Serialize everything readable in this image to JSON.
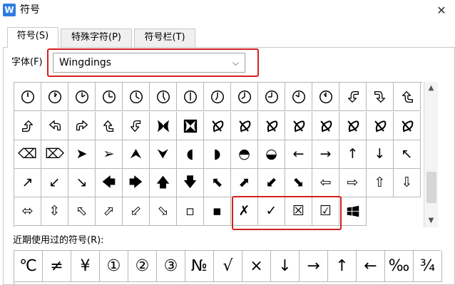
{
  "window": {
    "title": "符号",
    "app_icon_letter": "W",
    "close_glyph": "✕"
  },
  "tabs": [
    {
      "label": "符号(S)",
      "active": true
    },
    {
      "label": "特殊字符(P)",
      "active": false
    },
    {
      "label": "符号栏(T)",
      "active": false
    }
  ],
  "font": {
    "label": "字体(F)",
    "value": "Wingdings",
    "chevron": "⌵"
  },
  "grid": {
    "rows": [
      [
        {
          "icon": "clock-12-icon"
        },
        {
          "icon": "clock-1-icon"
        },
        {
          "icon": "clock-2-icon"
        },
        {
          "icon": "clock-3-icon"
        },
        {
          "icon": "clock-4-icon"
        },
        {
          "icon": "clock-5-icon"
        },
        {
          "icon": "clock-6-icon"
        },
        {
          "icon": "clock-7-icon"
        },
        {
          "icon": "clock-8-icon"
        },
        {
          "icon": "clock-9-icon"
        },
        {
          "icon": "clock-10-icon"
        },
        {
          "icon": "clock-11-icon"
        },
        {
          "icon": "curved-arrow-down-left-icon"
        },
        {
          "icon": "curved-arrow-down-right-icon"
        },
        {
          "icon": "curved-arrow-up-left-icon"
        }
      ],
      [
        {
          "icon": "curved-arrow-up-right-icon"
        },
        {
          "icon": "curved-arrow-left-icon"
        },
        {
          "icon": "curved-arrow-right-icon"
        },
        {
          "icon": "curved-arrow-up-icon"
        },
        {
          "icon": "curved-arrow-down-icon"
        },
        {
          "icon": "ornament-leaf-icon"
        },
        {
          "icon": "ornament-square-icon"
        },
        {
          "icon": "ampersand-leaf-icon"
        },
        {
          "icon": "ampersand-leaf-icon"
        },
        {
          "icon": "ampersand-leaf-icon"
        },
        {
          "icon": "ampersand-leaf-icon"
        },
        {
          "icon": "ampersand-leaf-icon"
        },
        {
          "icon": "ampersand-leaf-icon"
        },
        {
          "icon": "ampersand-leaf-icon"
        },
        {
          "icon": "ampersand-leaf-icon"
        }
      ],
      [
        {
          "glyph": "⌫"
        },
        {
          "glyph": "⌦"
        },
        {
          "glyph": "➤"
        },
        {
          "glyph": "➢"
        },
        {
          "glyph": "⮝"
        },
        {
          "glyph": "⮟"
        },
        {
          "glyph": "◖"
        },
        {
          "glyph": "◗"
        },
        {
          "glyph": "◓"
        },
        {
          "glyph": "◒"
        },
        {
          "glyph": "←"
        },
        {
          "glyph": "→"
        },
        {
          "glyph": "↑"
        },
        {
          "glyph": "↓"
        },
        {
          "glyph": "↖"
        }
      ],
      [
        {
          "glyph": "↗"
        },
        {
          "glyph": "↙"
        },
        {
          "glyph": "↘"
        },
        {
          "glyph": "🡄"
        },
        {
          "glyph": "🡆"
        },
        {
          "glyph": "🡅"
        },
        {
          "glyph": "🡇"
        },
        {
          "glyph": "⬉"
        },
        {
          "glyph": "⬈"
        },
        {
          "glyph": "⬋"
        },
        {
          "glyph": "⬊"
        },
        {
          "glyph": "⇦"
        },
        {
          "glyph": "⇨"
        },
        {
          "glyph": "⇧"
        },
        {
          "glyph": "⇩"
        }
      ],
      [
        {
          "glyph": "⬄"
        },
        {
          "glyph": "⇳"
        },
        {
          "glyph": "⬁"
        },
        {
          "glyph": "⬀"
        },
        {
          "glyph": "⬃"
        },
        {
          "glyph": "⬂"
        },
        {
          "glyph": "▫"
        },
        {
          "glyph": "▪"
        },
        {
          "glyph": "✗"
        },
        {
          "glyph": "✓"
        },
        {
          "glyph": "☒"
        },
        {
          "glyph": "☑"
        },
        {
          "icon": "windows-logo-icon"
        }
      ]
    ]
  },
  "recent": {
    "label": "近期使用过的符号(R):",
    "symbols": [
      "℃",
      "≠",
      "¥",
      "①",
      "②",
      "③",
      "№",
      "√",
      "×",
      "↓",
      "→",
      "↑",
      "←",
      "‰",
      "¾"
    ]
  },
  "colors": {
    "highlight": "#d42020",
    "app_icon": "#2f7de1"
  }
}
